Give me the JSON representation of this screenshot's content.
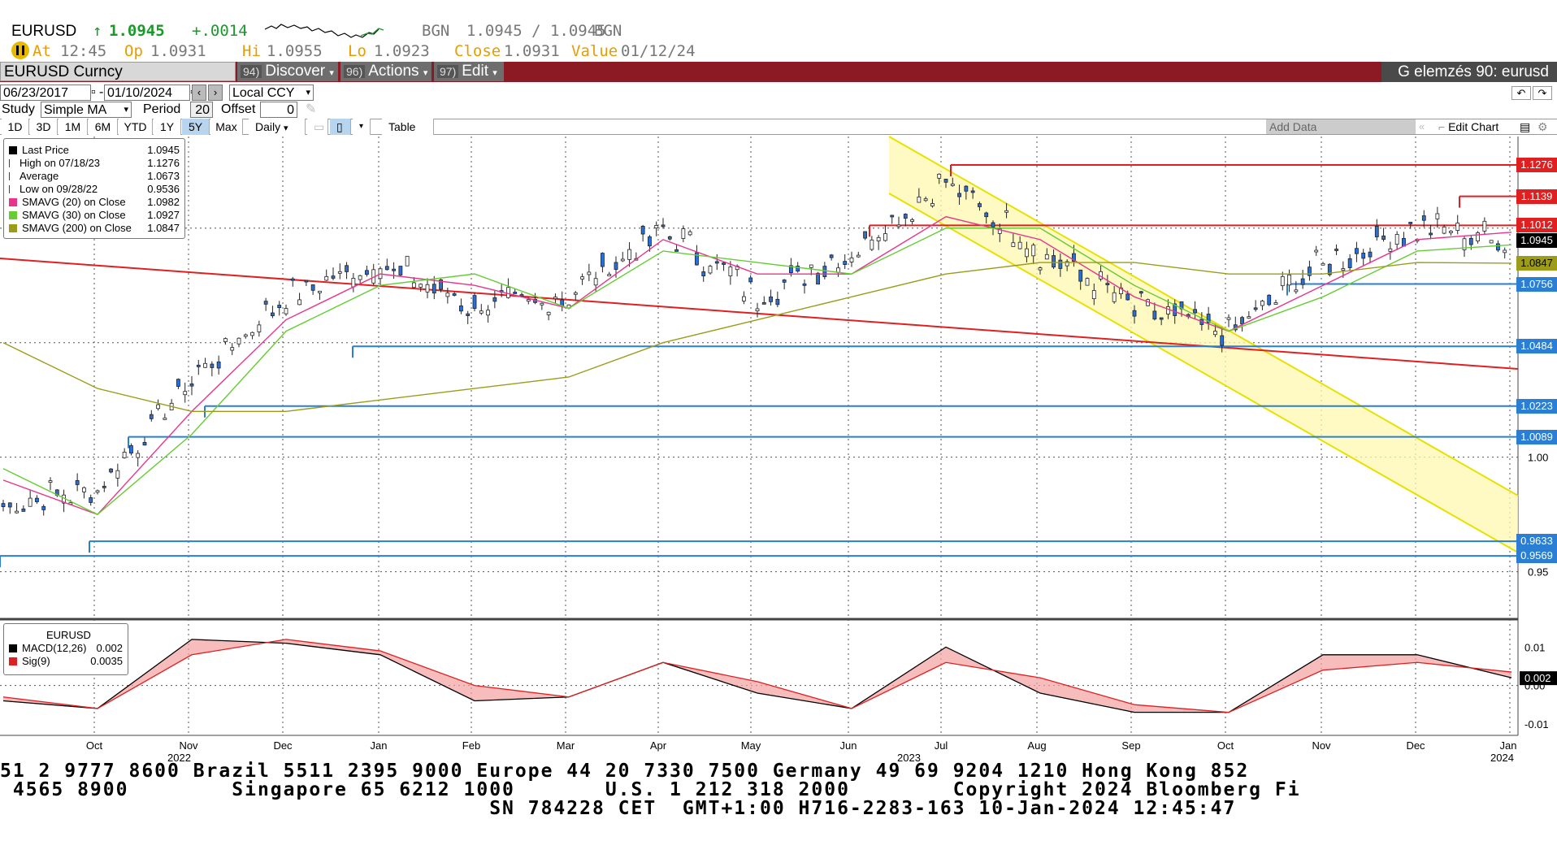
{
  "quote": {
    "ticker": "EURUSD",
    "arrow": "↑",
    "last": "1.0945",
    "change": "+.0014",
    "bid_src": "BGN",
    "bid_ask": "1.0945 / 1.0945",
    "ask_src": "BGN",
    "at_label": "At",
    "at_value": "12:45",
    "op_label": "Op",
    "op_value": "1.0931",
    "hi_label": "Hi",
    "hi_value": "1.0955",
    "lo_label": "Lo",
    "lo_value": "1.0923",
    "close_label": "Close",
    "close_value": "1.0931",
    "value_label": "Value",
    "value_date": "01/12/24"
  },
  "toolbar": {
    "security": "EURUSD Curncy",
    "discover_num": "94)",
    "discover": "Discover",
    "actions_num": "96)",
    "actions": "Actions",
    "edit_num": "97)",
    "edit": "Edit",
    "title": "G elemzés 90: eurusd"
  },
  "controls": {
    "start_date": "06/23/2017",
    "end_date": "01/10/2024",
    "currency": "Local CCY",
    "study_label": "Study",
    "study_value": "Simple MA",
    "period_label": "Period",
    "period_value": "20",
    "offset_label": "Offset",
    "offset_value": "0"
  },
  "range_buttons": [
    "1D",
    "3D",
    "1M",
    "6M",
    "YTD",
    "1Y",
    "5Y",
    "Max"
  ],
  "selected_range": "5Y",
  "frequency": "Daily",
  "table_label": "Table",
  "add_data_placeholder": "Add Data",
  "edit_chart_label": "Edit Chart",
  "legend": [
    {
      "label": "Last Price",
      "value": "1.0945",
      "color": "#000000",
      "marker": "square"
    },
    {
      "label": "High on 07/18/23",
      "value": "1.1276",
      "color": "#000000",
      "marker": "high"
    },
    {
      "label": "Average",
      "value": "1.0673",
      "color": "#555555",
      "marker": "avg"
    },
    {
      "label": "Low on 09/28/22",
      "value": "0.9536",
      "color": "#000000",
      "marker": "low"
    },
    {
      "label": "SMAVG (20)  on Close",
      "value": "1.0982",
      "color": "#e8348c",
      "marker": "square"
    },
    {
      "label": "SMAVG (30)  on Close",
      "value": "1.0927",
      "color": "#66cc33",
      "marker": "square"
    },
    {
      "label": "SMAVG (200)  on Close",
      "value": "1.0847",
      "color": "#9c9c1a",
      "marker": "square"
    }
  ],
  "macd_legend": {
    "title": "EURUSD",
    "items": [
      {
        "label": "MACD(12,26)",
        "value": "0.002",
        "color": "#000000"
      },
      {
        "label": "Sig(9)",
        "value": "0.0035",
        "color": "#e02020"
      }
    ]
  },
  "price_tags": [
    {
      "label": "1.1276",
      "bg": "#e02020"
    },
    {
      "label": "1.1139",
      "bg": "#e02020"
    },
    {
      "label": "1.1012",
      "bg": "#e02020"
    },
    {
      "label": "1.0945",
      "bg": "#000000"
    },
    {
      "label": "1.0847",
      "bg": "#9c9c1a"
    },
    {
      "label": "1.0756",
      "bg": "#2a7fd4"
    },
    {
      "label": "1.0484",
      "bg": "#2a7fd4"
    },
    {
      "label": "1.0223",
      "bg": "#2a7fd4"
    },
    {
      "label": "1.0089",
      "bg": "#2a7fd4"
    },
    {
      "label": "0.9633",
      "bg": "#2a7fd4"
    },
    {
      "label": "0.9569",
      "bg": "#2a7fd4"
    }
  ],
  "price_axis_ticks": [
    "1.00",
    "0.95"
  ],
  "macd_axis_ticks": [
    "0.01",
    "0.00",
    "-0.01"
  ],
  "macd_tag": "0.002",
  "x_axis": {
    "months": [
      "Oct",
      "Nov",
      "Dec",
      "Jan",
      "Feb",
      "Mar",
      "Apr",
      "May",
      "Jun",
      "Jul",
      "Aug",
      "Sep",
      "Oct",
      "Nov",
      "Dec",
      "Jan"
    ],
    "years": [
      "2022",
      "2023",
      "2024"
    ]
  },
  "ticker_lines": [
    "51 2 9777 8600 Brazil 5511 2395 9000 Europe 44 20 7330 7500 Germany 49 69 9204 1210 Hong Kong 852",
    " 4565 8900        Singapore 65 6212 1000       U.S. 1 212 318 2000        Copyright 2024 Bloomberg Fi",
    "                                      SN 784228 CET  GMT+1:00 H716-2283-163 10-Jan-2024 12:45:47"
  ],
  "chart_data": {
    "type": "line",
    "title": "EURUSD",
    "x_range": [
      "2022-09",
      "2024-01"
    ],
    "ylim": [
      0.93,
      1.14
    ],
    "horizontal_levels": [
      1.1276,
      1.1139,
      1.1012,
      1.0756,
      1.0484,
      1.0223,
      1.0089,
      0.9633,
      0.9569
    ],
    "series": [
      {
        "name": "Last Price",
        "x": [
          "2022-09",
          "2022-10",
          "2022-11",
          "2022-12",
          "2023-01",
          "2023-02",
          "2023-03",
          "2023-04",
          "2023-05",
          "2023-06",
          "2023-07",
          "2023-08",
          "2023-09",
          "2023-10",
          "2023-11",
          "2023-12",
          "2024-01"
        ],
        "values": [
          0.98,
          0.985,
          1.035,
          1.07,
          1.085,
          1.065,
          1.07,
          1.1,
          1.07,
          1.09,
          1.12,
          1.09,
          1.065,
          1.055,
          1.085,
          1.1,
          1.0945
        ]
      },
      {
        "name": "SMAVG (20)",
        "values": [
          0.99,
          0.975,
          1.02,
          1.06,
          1.08,
          1.075,
          1.065,
          1.095,
          1.08,
          1.08,
          1.105,
          1.095,
          1.07,
          1.055,
          1.075,
          1.095,
          1.0982
        ]
      },
      {
        "name": "SMAVG (30)",
        "values": [
          0.995,
          0.975,
          1.01,
          1.055,
          1.075,
          1.08,
          1.065,
          1.09,
          1.085,
          1.08,
          1.1,
          1.1,
          1.075,
          1.055,
          1.07,
          1.09,
          1.0927
        ]
      },
      {
        "name": "SMAVG (200)",
        "values": [
          1.05,
          1.03,
          1.02,
          1.02,
          1.025,
          1.03,
          1.035,
          1.05,
          1.06,
          1.07,
          1.08,
          1.085,
          1.085,
          1.08,
          1.08,
          1.085,
          1.0847
        ]
      }
    ],
    "macd": {
      "x": [
        "2022-09",
        "2022-10",
        "2022-11",
        "2022-12",
        "2023-01",
        "2023-02",
        "2023-03",
        "2023-04",
        "2023-05",
        "2023-06",
        "2023-07",
        "2023-08",
        "2023-09",
        "2023-10",
        "2023-11",
        "2023-12",
        "2024-01"
      ],
      "macd": [
        -0.004,
        -0.006,
        0.012,
        0.011,
        0.008,
        -0.004,
        -0.003,
        0.006,
        -0.002,
        -0.006,
        0.01,
        -0.002,
        -0.007,
        -0.007,
        0.008,
        0.008,
        0.002
      ],
      "signal": [
        -0.003,
        -0.006,
        0.008,
        0.012,
        0.009,
        0.0,
        -0.003,
        0.006,
        0.001,
        -0.006,
        0.006,
        0.002,
        -0.005,
        -0.007,
        0.004,
        0.006,
        0.0035
      ]
    }
  }
}
